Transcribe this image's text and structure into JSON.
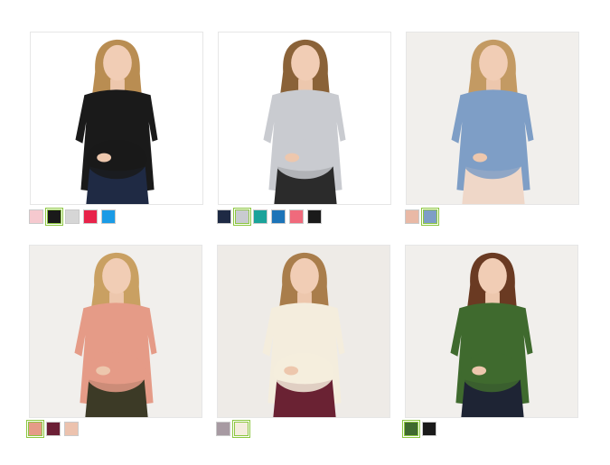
{
  "products": [
    {
      "name": "black-scoopneck-maternity-top",
      "bg": "#ffffff",
      "garment": "#1a1a1a",
      "pants": "#1f2a44",
      "hair": "#b98d52",
      "swatches": [
        {
          "color": "#f6c9cf",
          "selected": false
        },
        {
          "color": "#1a1a1a",
          "selected": true
        },
        {
          "color": "#d6d6d6",
          "selected": false
        },
        {
          "color": "#e8234a",
          "selected": false
        },
        {
          "color": "#1a9be6",
          "selected": false
        }
      ]
    },
    {
      "name": "gray-maternity-tunic",
      "bg": "#ffffff",
      "garment": "#c9cbd0",
      "pants": "#2b2b2b",
      "hair": "#8a6238",
      "swatches": [
        {
          "color": "#1e2a44",
          "selected": false
        },
        {
          "color": "#c9cbd0",
          "selected": true
        },
        {
          "color": "#1aa39a",
          "selected": false
        },
        {
          "color": "#1c74b8",
          "selected": false
        },
        {
          "color": "#f06a7c",
          "selected": false
        },
        {
          "color": "#1a1a1a",
          "selected": false
        }
      ]
    },
    {
      "name": "chambray-off-shoulder-maternity-top",
      "bg": "#f1efec",
      "garment": "#7e9ec6",
      "pants": "#efd7c8",
      "hair": "#c39a63",
      "swatches": [
        {
          "color": "#e9b9a6",
          "selected": false
        },
        {
          "color": "#7e9ec6",
          "selected": true
        }
      ]
    },
    {
      "name": "pink-peasant-maternity-top",
      "bg": "#f1efec",
      "garment": "#e59b87",
      "pants": "#3c3a26",
      "hair": "#c9a062",
      "swatches": [
        {
          "color": "#e59b87",
          "selected": true
        },
        {
          "color": "#6b1f35",
          "selected": false
        },
        {
          "color": "#ecc2ae",
          "selected": false
        }
      ]
    },
    {
      "name": "cream-lace-maternity-blouse",
      "bg": "#eeebe7",
      "garment": "#f4eddd",
      "pants": "#6a2233",
      "hair": "#a97d4b",
      "swatches": [
        {
          "color": "#a79aa2",
          "selected": false
        },
        {
          "color": "#f4eddd",
          "selected": true
        }
      ]
    },
    {
      "name": "green-floral-wrap-maternity-top",
      "bg": "#f1efec",
      "garment": "#3f6a2e",
      "pants": "#1e2434",
      "hair": "#6a3a22",
      "swatches": [
        {
          "color": "#3f6a2e",
          "selected": true
        },
        {
          "color": "#1a1a1a",
          "selected": false
        }
      ]
    }
  ]
}
